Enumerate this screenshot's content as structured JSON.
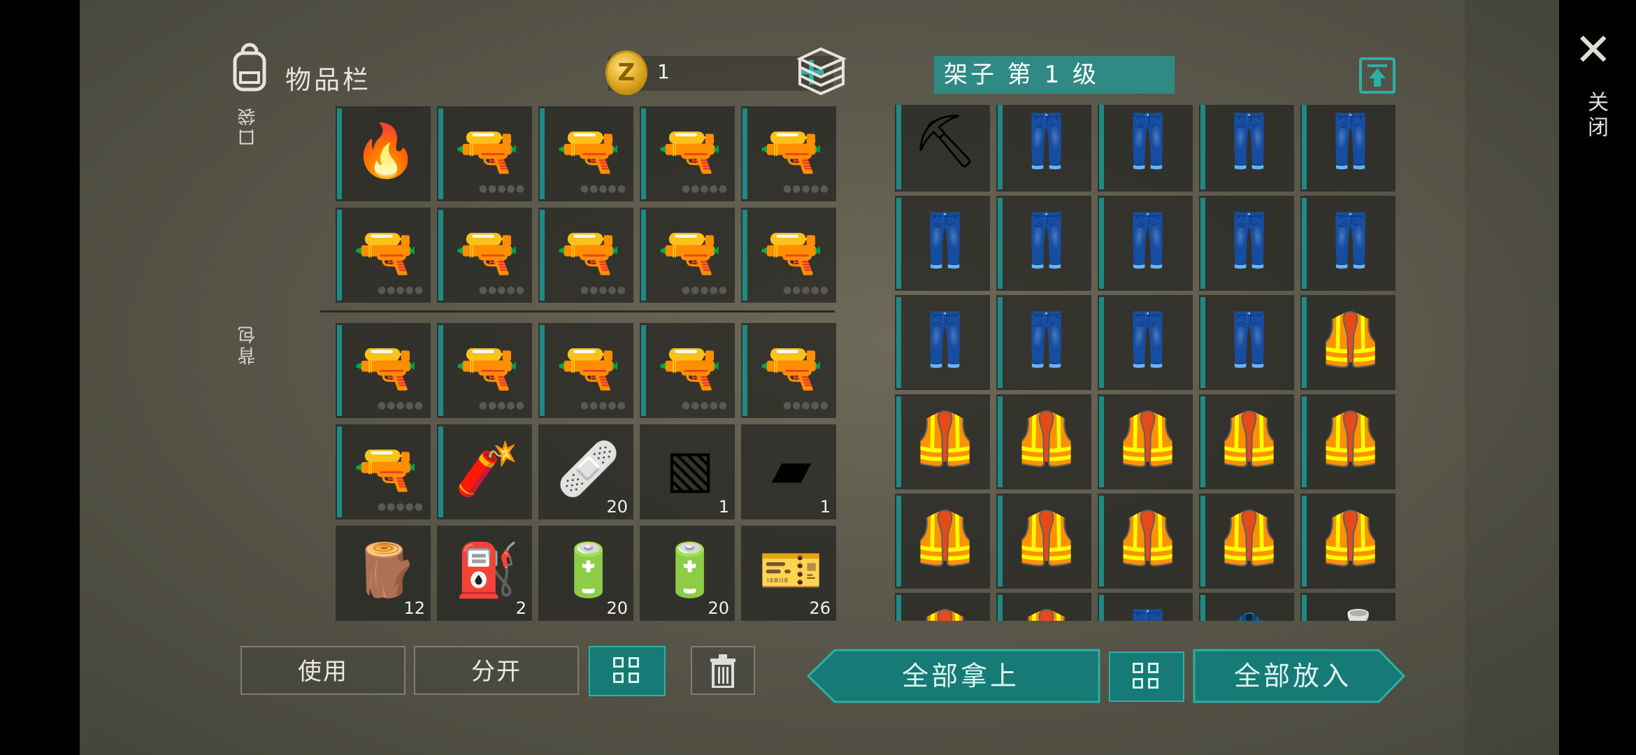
{
  "inventory": {
    "title": "物品栏",
    "coins": "1",
    "coin_symbol": "Z",
    "add_symbol": "+",
    "pocket_label": "口袋",
    "backpack_label": "背包",
    "pocket_items": [
      {
        "icon": "flamethrower-icon",
        "glyph": "🔥",
        "count": ""
      },
      {
        "icon": "sniper-rifle-icon",
        "glyph": "🔫",
        "count": ""
      },
      {
        "icon": "pistol-icon",
        "glyph": "🔫",
        "count": ""
      },
      {
        "icon": "pistol-icon",
        "glyph": "🔫",
        "count": ""
      },
      {
        "icon": "pistol-icon",
        "glyph": "🔫",
        "count": ""
      },
      {
        "icon": "pistol-icon",
        "glyph": "🔫",
        "count": ""
      },
      {
        "icon": "pistol-icon",
        "glyph": "🔫",
        "count": ""
      },
      {
        "icon": "pistol-icon",
        "glyph": "🔫",
        "count": ""
      },
      {
        "icon": "pistol-icon",
        "glyph": "🔫",
        "count": ""
      },
      {
        "icon": "pistol-icon",
        "glyph": "🔫",
        "count": ""
      }
    ],
    "backpack_items": [
      {
        "icon": "pistol-icon",
        "glyph": "🔫",
        "count": ""
      },
      {
        "icon": "pistol-icon",
        "glyph": "🔫",
        "count": ""
      },
      {
        "icon": "pistol-icon",
        "glyph": "🔫",
        "count": ""
      },
      {
        "icon": "pistol-icon",
        "glyph": "🔫",
        "count": ""
      },
      {
        "icon": "pistol-icon",
        "glyph": "🔫",
        "count": ""
      },
      {
        "icon": "pistol-icon",
        "glyph": "🔫",
        "count": ""
      },
      {
        "icon": "flare-gun-icon",
        "glyph": "🧨",
        "count": ""
      },
      {
        "icon": "bandage-icon",
        "glyph": "🩹",
        "count": "20"
      },
      {
        "icon": "metal-plate-icon",
        "glyph": "▧",
        "count": "1"
      },
      {
        "icon": "steel-ingot-icon",
        "glyph": "▰",
        "count": "1"
      },
      {
        "icon": "wood-plank-icon",
        "glyph": "🪵",
        "count": "12"
      },
      {
        "icon": "gas-canister-icon",
        "glyph": "⛽",
        "count": "2"
      },
      {
        "icon": "batteries-icon",
        "glyph": "🔋",
        "count": "20"
      },
      {
        "icon": "batteries-icon",
        "glyph": "🔋",
        "count": "20"
      },
      {
        "icon": "coupon-icon",
        "glyph": "🎫",
        "count": "26"
      }
    ],
    "use_label": "使用",
    "split_label": "分开"
  },
  "shelf": {
    "title": "架子 第 1 级",
    "take_all_label": "全部拿上",
    "put_all_label": "全部放入",
    "items": [
      {
        "icon": "pickaxe-icon",
        "glyph": "⛏"
      },
      {
        "icon": "pants-icon",
        "glyph": "👖"
      },
      {
        "icon": "pants-icon",
        "glyph": "👖"
      },
      {
        "icon": "pants-icon",
        "glyph": "👖"
      },
      {
        "icon": "pants-icon",
        "glyph": "👖"
      },
      {
        "icon": "pants-icon",
        "glyph": "👖"
      },
      {
        "icon": "pants-icon",
        "glyph": "👖"
      },
      {
        "icon": "pants-icon",
        "glyph": "👖"
      },
      {
        "icon": "pants-icon",
        "glyph": "👖"
      },
      {
        "icon": "pants-icon",
        "glyph": "👖"
      },
      {
        "icon": "pants-icon",
        "glyph": "👖"
      },
      {
        "icon": "pants-icon",
        "glyph": "👖"
      },
      {
        "icon": "pants-icon",
        "glyph": "👖"
      },
      {
        "icon": "pants-icon",
        "glyph": "👖"
      },
      {
        "icon": "police-vest-icon",
        "glyph": "🦺"
      },
      {
        "icon": "police-vest-icon",
        "glyph": "🦺"
      },
      {
        "icon": "police-vest-icon",
        "glyph": "🦺"
      },
      {
        "icon": "police-vest-icon",
        "glyph": "🦺"
      },
      {
        "icon": "police-vest-icon",
        "glyph": "🦺"
      },
      {
        "icon": "police-vest-icon",
        "glyph": "🦺"
      },
      {
        "icon": "police-vest-icon",
        "glyph": "🦺"
      },
      {
        "icon": "police-vest-icon",
        "glyph": "🦺"
      },
      {
        "icon": "police-vest-icon",
        "glyph": "🦺"
      },
      {
        "icon": "police-vest-icon",
        "glyph": "🦺"
      },
      {
        "icon": "police-vest-icon",
        "glyph": "🦺"
      },
      {
        "icon": "police-vest-icon",
        "glyph": "🦺"
      },
      {
        "icon": "police-vest-icon",
        "glyph": "🦺"
      },
      {
        "icon": "jeans-icon",
        "glyph": "👖"
      },
      {
        "icon": "jacket-icon",
        "glyph": "🧥"
      },
      {
        "icon": "bottle-icon",
        "glyph": "🍶"
      }
    ]
  },
  "close_label": "关闭",
  "colors": {
    "accent": "#1d8a86",
    "teal_button": "#167a76",
    "coin": "#d9a21a"
  }
}
